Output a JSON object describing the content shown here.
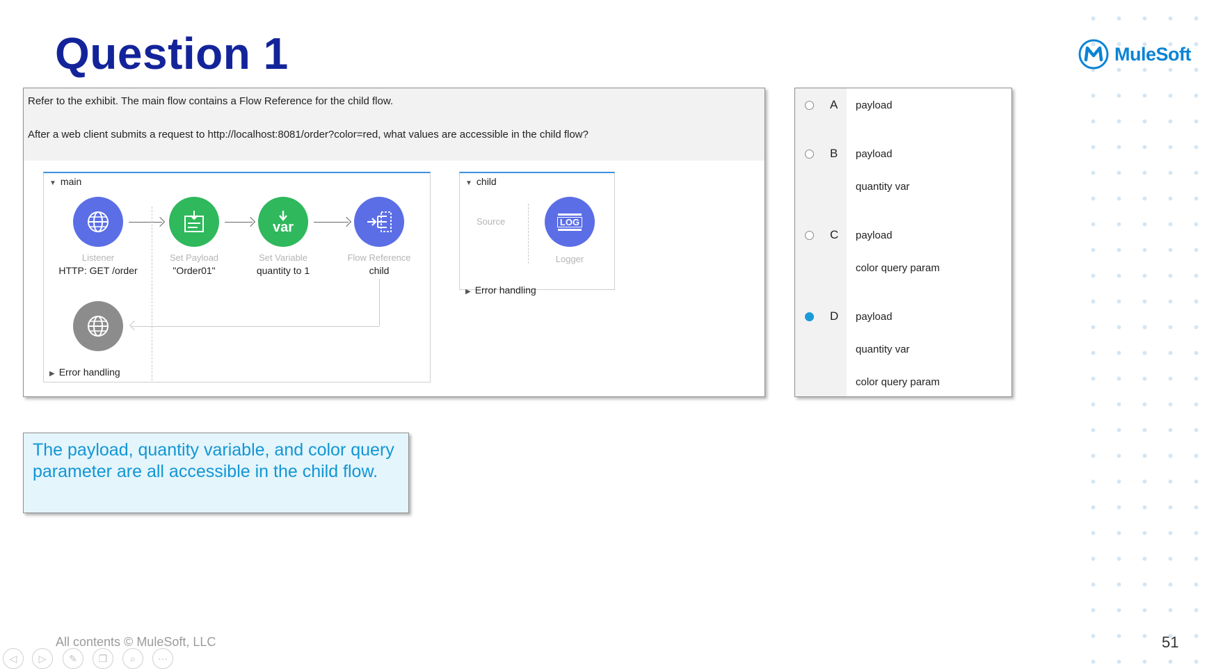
{
  "slide": {
    "title": "Question 1",
    "logo_text": "MuleSoft",
    "footer": "All contents © MuleSoft, LLC",
    "page_number": "51"
  },
  "question": {
    "line1": "Refer to the exhibit. The main flow contains a Flow Reference for the child flow.",
    "line2": "After a web client submits a request to http://localhost:8081/order?color=red, what values are accessible in the child flow?"
  },
  "diagram": {
    "main": {
      "name": "main",
      "nodes": [
        {
          "label": "Listener",
          "value": "HTTP: GET /order",
          "icon": "globe-icon",
          "color": "#5b6ee6"
        },
        {
          "label": "Set Payload",
          "value": "\"Order01\"",
          "icon": "set-payload-icon",
          "color": "#2fb85c"
        },
        {
          "label": "Set Variable",
          "value": "quantity to 1",
          "icon": "var-icon",
          "icon_text": "var",
          "color": "#2fb85c"
        },
        {
          "label": "Flow Reference",
          "value": "child",
          "icon": "flow-reference-icon",
          "color": "#5b6ee6"
        }
      ],
      "response_icon": "globe-icon",
      "response_color": "#8c8c8c",
      "error_handling": "Error handling"
    },
    "child": {
      "name": "child",
      "source_label": "Source",
      "logger_label": "Logger",
      "logger_icon_text": "LOG",
      "logger_color": "#5b6ee6",
      "error_handling": "Error handling"
    }
  },
  "answers": [
    {
      "letter": "A",
      "lines": [
        "payload"
      ],
      "selected": false
    },
    {
      "letter": "B",
      "lines": [
        "payload",
        "quantity var"
      ],
      "selected": false
    },
    {
      "letter": "C",
      "lines": [
        "payload",
        "color query param"
      ],
      "selected": false
    },
    {
      "letter": "D",
      "lines": [
        "payload",
        "quantity var",
        "color query param"
      ],
      "selected": true
    }
  ],
  "explanation": "The payload, quantity variable, and color query parameter are all accessible in the child flow.",
  "toolbar": [
    {
      "icon": "previous-icon",
      "glyph": "◁"
    },
    {
      "icon": "next-icon",
      "glyph": "▷"
    },
    {
      "icon": "pen-icon",
      "glyph": "✎"
    },
    {
      "icon": "slides-icon",
      "glyph": "❐"
    },
    {
      "icon": "zoom-icon",
      "glyph": "⌕"
    },
    {
      "icon": "more-icon",
      "glyph": "⋯"
    }
  ],
  "colors": {
    "title": "#13249a",
    "accent": "#1296d4",
    "selected_radio": "#1a9ad8"
  }
}
